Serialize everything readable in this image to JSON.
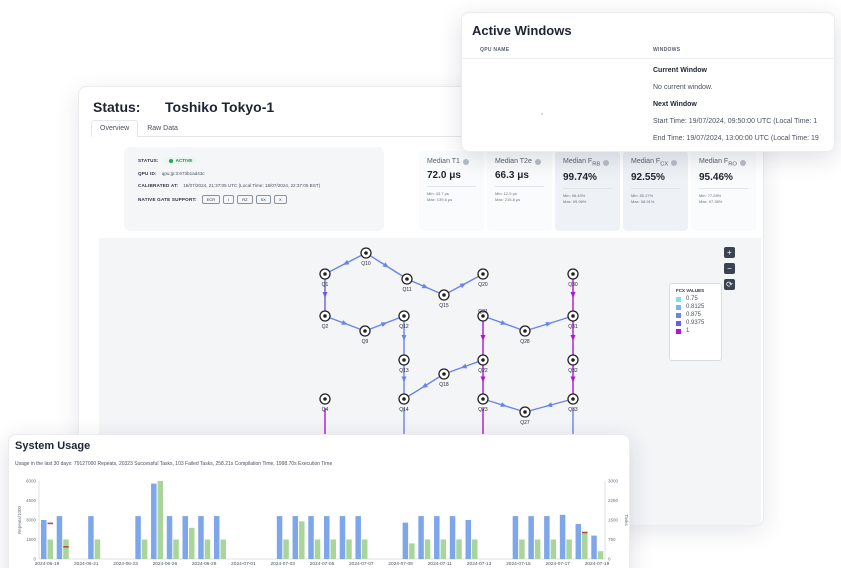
{
  "status": {
    "label": "Status:",
    "device_name": "Toshiko Tokyo-1",
    "tabs": [
      {
        "label": "Overview",
        "active": true
      },
      {
        "label": "Raw Data",
        "active": false
      }
    ],
    "info": {
      "status_key": "STATUS:",
      "status_value": "ACTIVE",
      "qpu_id_key": "QPU ID:",
      "qpu_id_value": "qpu:jp:3:673b1ad43c",
      "calibrated_key": "CALIBRATED AT:",
      "calibrated_value": "18/07/2024, 21:37:05 UTC (Local Time: 18/07/2024, 22:37:05 BST)",
      "gate_key": "NATIVE GATE SUPPORT:",
      "gates": [
        "ECR",
        "I",
        "RZ",
        "SX",
        "X"
      ]
    },
    "metrics": [
      {
        "label": "Median T1",
        "value": "72.0 μs",
        "min": "Min: 43.7 μs",
        "max": "Max: 139.6 μs",
        "tinted": false
      },
      {
        "label": "Median T2e",
        "value": "66.3 μs",
        "min": "Min: 12.9 μs",
        "max": "Max: 215.8 μs",
        "tinted": false
      },
      {
        "label": "Median F",
        "sub": "RB",
        "value": "99.74%",
        "min": "Min: 98.45%",
        "max": "Max: 99.96%",
        "tinted": true
      },
      {
        "label": "Median F",
        "sub": "CX",
        "value": "92.55%",
        "min": "Min: 80.27%",
        "max": "Max: 98.91%",
        "tinted": true
      },
      {
        "label": "Median F",
        "sub": "RO",
        "value": "95.46%",
        "min": "Min: 77.28%",
        "max": "Max: 97.35%",
        "tinted": false
      }
    ],
    "zoom": {
      "in": "+",
      "out": "−",
      "reset": "⟳"
    },
    "legend": {
      "title": "FCX VALUES",
      "items": [
        {
          "label": "0.75",
          "color": "#7fe0e6"
        },
        {
          "label": "0.8125",
          "color": "#79b4f0"
        },
        {
          "label": "0.875",
          "color": "#6a84e8"
        },
        {
          "label": "0.9375",
          "color": "#6f5be0"
        },
        {
          "label": "1",
          "color": "#b313d9"
        }
      ]
    },
    "qubits": [
      {
        "label": "Q10"
      },
      {
        "label": "Q1"
      },
      {
        "label": "Q11"
      },
      {
        "label": "Q15"
      },
      {
        "label": "Q20"
      },
      {
        "label": "Q30"
      },
      {
        "label": "Q2"
      },
      {
        "label": "Q9"
      },
      {
        "label": "Q12"
      },
      {
        "label": "Q21"
      },
      {
        "label": "Q28"
      },
      {
        "label": "Q31"
      },
      {
        "label": "Q13"
      },
      {
        "label": "Q22"
      },
      {
        "label": "Q32"
      },
      {
        "label": "Q18"
      },
      {
        "label": "Q4"
      },
      {
        "label": "Q14"
      },
      {
        "label": "Q23"
      },
      {
        "label": "Q33"
      },
      {
        "label": "Q27"
      }
    ]
  },
  "windows": {
    "title": "Active Windows",
    "col_qpu": "QPU NAME",
    "col_windows": "WINDOWS",
    "current_heading": "Current Window",
    "current_text": "No current window.",
    "next_heading": "Next Window",
    "start_text": "Start Time: 19/07/2024, 09:50:00 UTC (Local Time: 1",
    "end_text": "End Time: 19/07/2024, 13:00:00 UTC (Local Time: 19"
  },
  "usage": {
    "title": "System Usage",
    "subtitle": "Usage in the last 30 days: 79127000 Repeats, 20323 Successful Tasks, 103 Failed Tasks, 258.21s Compilation Time, 1998.70s Execution Time"
  },
  "chart_data": {
    "type": "bar",
    "ylabel": "Repeats/1000",
    "y2label": "Tasks",
    "ylim": [
      0,
      6000
    ],
    "y2lim": [
      0,
      3000
    ],
    "yticks": [
      "0",
      "1500",
      "3000",
      "4500",
      "6000"
    ],
    "y2ticks": [
      "0",
      "750",
      "1500",
      "2250",
      "3000"
    ],
    "xtick_labels": [
      "2024-06-19",
      "2024-06-21",
      "2024-06-23",
      "2024-06-26",
      "2024-06-29",
      "2024-07-01",
      "2024-07-03",
      "2024-07-05",
      "2024-07-07",
      "2024-07-09",
      "2024-07-11",
      "2024-07-13",
      "2024-07-15",
      "2024-07-17",
      "2024-07-19"
    ],
    "series": [
      {
        "color": "#7da7ea",
        "values": [
          3000,
          3300,
          0,
          3300,
          0,
          0,
          3300,
          5800,
          3300,
          3300,
          3300,
          3300,
          0,
          0,
          0,
          3300,
          3300,
          3300,
          3300,
          3300,
          3300,
          0,
          0,
          2800,
          3300,
          3300,
          3300,
          3000,
          0,
          0,
          3300,
          3300,
          3300,
          3400,
          2700,
          1800
        ]
      },
      {
        "color": "#a9d59b",
        "values": [
          1500,
          1500,
          0,
          1500,
          0,
          0,
          1500,
          6000,
          1500,
          2400,
          1500,
          1500,
          0,
          0,
          0,
          1500,
          2900,
          1500,
          1500,
          1500,
          1500,
          0,
          0,
          1200,
          1500,
          1500,
          1500,
          1500,
          0,
          0,
          1500,
          1500,
          1500,
          1500,
          2000,
          600
        ]
      },
      {
        "color": "#b9493a",
        "values": [
          2800,
          1000,
          0,
          0,
          0,
          0,
          0,
          0,
          0,
          0,
          0,
          0,
          0,
          0,
          0,
          0,
          0,
          0,
          0,
          0,
          0,
          0,
          0,
          0,
          0,
          0,
          0,
          0,
          0,
          0,
          0,
          0,
          0,
          0,
          2100,
          0
        ]
      }
    ]
  }
}
